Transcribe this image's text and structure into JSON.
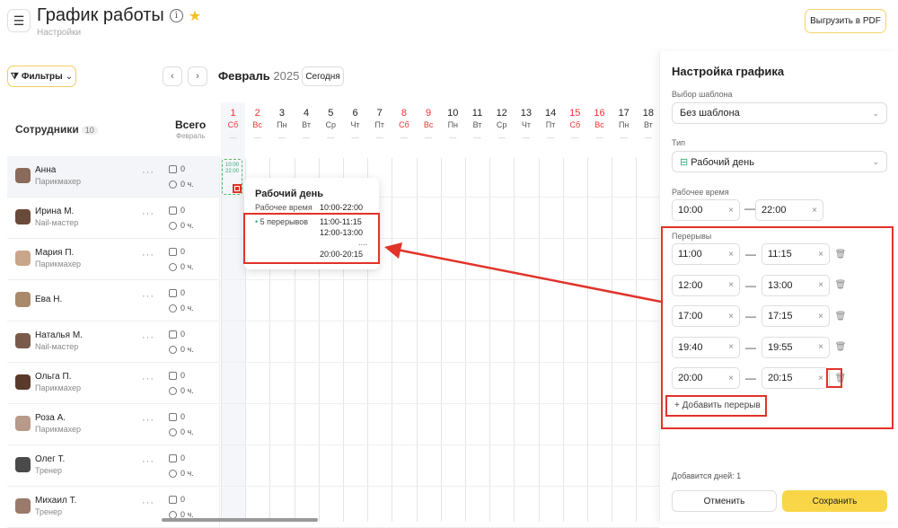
{
  "header": {
    "title": "График работы",
    "breadcrumb": "Настройки",
    "pdf_label": "Выгрузить в PDF"
  },
  "toolbar": {
    "filters_label": "Фильтры",
    "month": "Февраль",
    "year": "2025",
    "today_label": "Сегодня"
  },
  "table_head": {
    "employees_label": "Сотрудники",
    "employees_count": "10",
    "total_label": "Всего",
    "total_sub": "Февраль"
  },
  "days": [
    {
      "n": "1",
      "w": "Сб"
    },
    {
      "n": "2",
      "w": "Вс"
    },
    {
      "n": "3",
      "w": "Пн"
    },
    {
      "n": "4",
      "w": "Вт"
    },
    {
      "n": "5",
      "w": "Ср"
    },
    {
      "n": "6",
      "w": "Чт"
    },
    {
      "n": "7",
      "w": "Пт"
    },
    {
      "n": "8",
      "w": "Сб"
    },
    {
      "n": "9",
      "w": "Вс"
    },
    {
      "n": "10",
      "w": "Пн"
    },
    {
      "n": "11",
      "w": "Вт"
    },
    {
      "n": "12",
      "w": "Ср"
    },
    {
      "n": "13",
      "w": "Чт"
    },
    {
      "n": "14",
      "w": "Пт"
    },
    {
      "n": "15",
      "w": "Сб"
    },
    {
      "n": "16",
      "w": "Вс"
    },
    {
      "n": "17",
      "w": "Пн"
    },
    {
      "n": "18",
      "w": "Вт"
    }
  ],
  "employees": [
    {
      "name": "Анна",
      "role": "Парикмахер",
      "count": "0",
      "hours": "0 ч."
    },
    {
      "name": "Ирина М.",
      "role": "Nail-мастер",
      "count": "0",
      "hours": "0 ч."
    },
    {
      "name": "Мария П.",
      "role": "Парикмахер",
      "count": "0",
      "hours": "0 ч."
    },
    {
      "name": "Ева Н.",
      "role": "",
      "count": "0",
      "hours": "0 ч."
    },
    {
      "name": "Наталья М.",
      "role": "Nail-мастер",
      "count": "0",
      "hours": "0 ч."
    },
    {
      "name": "Ольга П.",
      "role": "Парикмахер",
      "count": "0",
      "hours": "0 ч."
    },
    {
      "name": "Роза А.",
      "role": "Парикмахер",
      "count": "0",
      "hours": "0 ч."
    },
    {
      "name": "Олег Т.",
      "role": "Тренер",
      "count": "0",
      "hours": "0 ч."
    },
    {
      "name": "Михаил Т.",
      "role": "Тренер",
      "count": "0",
      "hours": "0 ч."
    }
  ],
  "cell": {
    "start": "10:00",
    "end": "22:00"
  },
  "tooltip": {
    "title": "Рабочий день",
    "work_label": "Рабочее время",
    "work_value": "10:00-22:00",
    "breaks_label": "5 перерывов",
    "b1": "11:00-11:15",
    "b2": "12:00-13:00",
    "ellipsis": "....",
    "b_last": "20:00-20:15"
  },
  "panel": {
    "title": "Настройка графика",
    "template_label": "Выбор шаблона",
    "template_value": "Без шаблона",
    "type_label": "Тип",
    "type_value": "Рабочий день",
    "work_label": "Рабочее время",
    "work_from": "10:00",
    "work_to": "22:00",
    "breaks_label": "Перерывы",
    "breaks": [
      {
        "from": "11:00",
        "to": "11:15"
      },
      {
        "from": "12:00",
        "to": "13:00"
      },
      {
        "from": "17:00",
        "to": "17:15"
      },
      {
        "from": "19:40",
        "to": "19:55"
      },
      {
        "from": "20:00",
        "to": "20:15"
      }
    ],
    "add_break_label": "Добавить перерыв",
    "added_days": "Добавится дней: 1",
    "cancel_label": "Отменить",
    "save_label": "Сохранить"
  },
  "colors": {
    "accent": "#f9d648",
    "annotation": "#e1332a",
    "weekend": "#e33",
    "workday": "#3a7"
  }
}
